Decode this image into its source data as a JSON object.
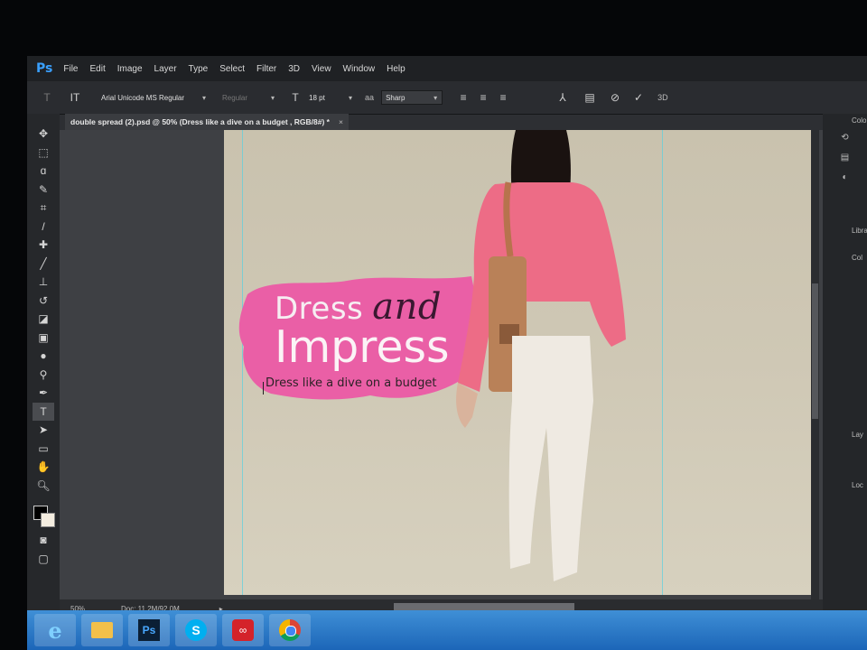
{
  "app": {
    "logo": "Ps"
  },
  "menu": [
    "File",
    "Edit",
    "Image",
    "Layer",
    "Type",
    "Select",
    "Filter",
    "3D",
    "View",
    "Window",
    "Help"
  ],
  "options": {
    "font_family": "Arial Unicode MS Regular",
    "font_style": "Regular",
    "font_size": "18 pt",
    "antialias_label": "aa",
    "antialias": "Sharp",
    "label_3d": "3D"
  },
  "document": {
    "tab_title": "double spread (2).psd @ 50% (Dress like a dive on a budget , RGB/8#) *",
    "close": "×"
  },
  "canvas": {
    "headline_word1": "Dress",
    "headline_word2": "and",
    "headline_word3": "Impress",
    "tagline": "Dress like a dive on a budget",
    "accent_color": "#ea5fa6"
  },
  "status": {
    "zoom": "50%",
    "doc_size": "Doc: 11.2M/92.0M"
  },
  "right_panels": {
    "color_tab": "Colo",
    "libraries_tab": "Libra",
    "color_label": "Col",
    "layers_tab": "Lay",
    "lock_label": "Loc"
  },
  "taskbar": {
    "ps_label": "Ps"
  }
}
